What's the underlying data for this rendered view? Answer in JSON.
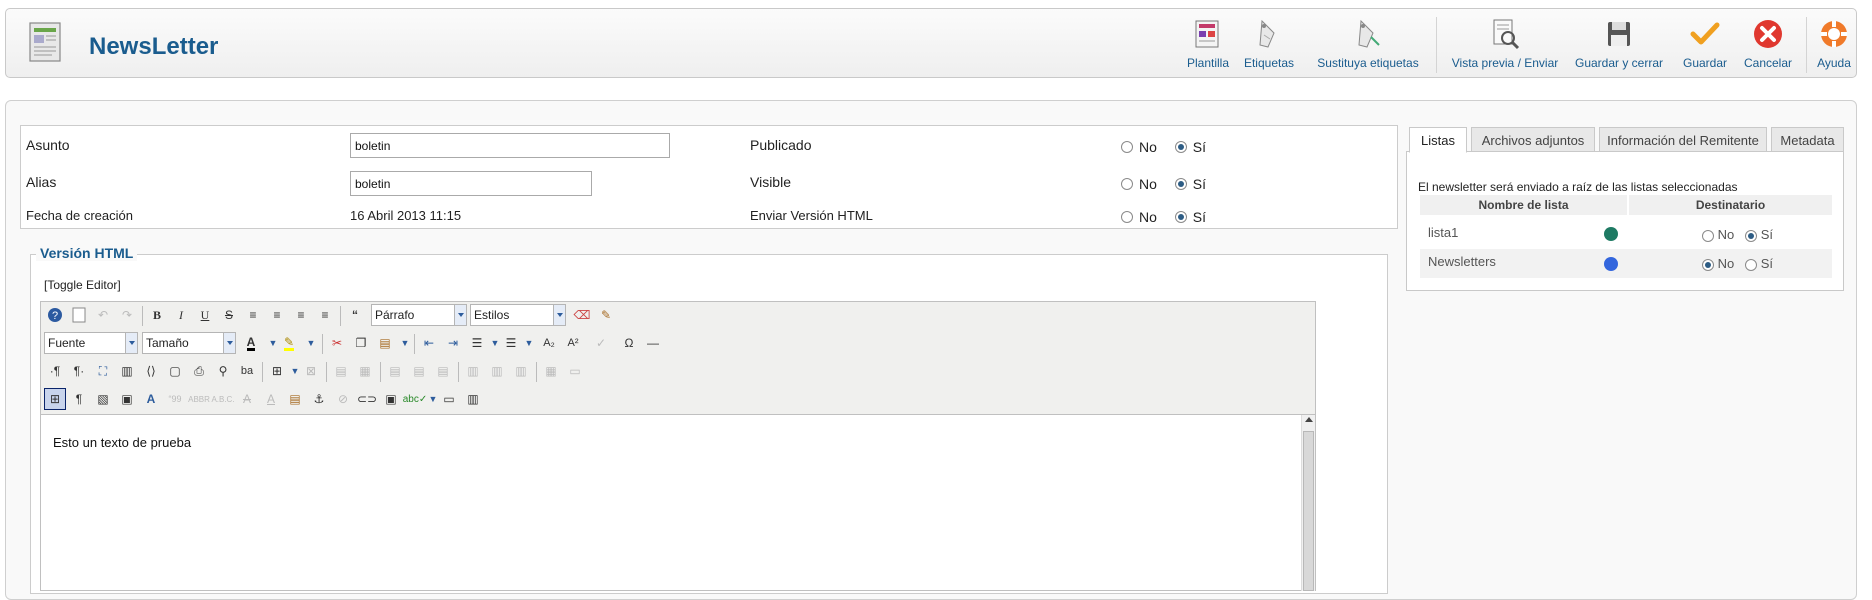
{
  "header": {
    "title": "NewsLetter",
    "buttons": [
      {
        "id": "plantilla",
        "label": "Plantilla",
        "icon": "template-icon"
      },
      {
        "id": "etiquetas",
        "label": "Etiquetas",
        "icon": "tag-icon"
      },
      {
        "id": "sustituya",
        "label": "Sustituya etiquetas",
        "icon": "replace-tags-icon"
      },
      {
        "id": "preview",
        "label": "Vista previa / Enviar",
        "icon": "preview-icon"
      },
      {
        "id": "save_close",
        "label": "Guardar y cerrar",
        "icon": "save-icon"
      },
      {
        "id": "save",
        "label": "Guardar",
        "icon": "check-icon"
      },
      {
        "id": "cancel",
        "label": "Cancelar",
        "icon": "cancel-icon"
      },
      {
        "id": "help",
        "label": "Ayuda",
        "icon": "help-icon"
      }
    ]
  },
  "details": {
    "asunto_label": "Asunto",
    "asunto_value": "boletin",
    "alias_label": "Alias",
    "alias_value": "boletin",
    "fecha_label": "Fecha de creación",
    "fecha_value": "16 Abril 2013 11:15",
    "publicado_label": "Publicado",
    "visible_label": "Visible",
    "html_label": "Enviar Versión HTML",
    "opt_no": "No",
    "opt_si": "Sí",
    "publicado_selected": "Sí",
    "visible_selected": "Sí",
    "html_selected": "Sí"
  },
  "editor": {
    "legend": "Versión HTML",
    "toggle": "[Toggle Editor]",
    "format_select": "Párrafo",
    "styles_select": "Estilos",
    "font_select": "Fuente",
    "size_select": "Tamaño",
    "content": "Esto un texto de prueba"
  },
  "panel": {
    "tabs": [
      "Listas",
      "Archivos adjuntos",
      "Información del Remitente",
      "Metadata"
    ],
    "active_tab": "Listas",
    "description": "El newsletter será enviado a raíz de las listas seleccionadas",
    "col_name": "Nombre de lista",
    "col_recipient": "Destinatario",
    "lists": [
      {
        "name": "lista1",
        "color": "#1e7a63",
        "selected": "Sí"
      },
      {
        "name": "Newsletters",
        "color": "#3366dd",
        "selected": "No"
      }
    ]
  }
}
